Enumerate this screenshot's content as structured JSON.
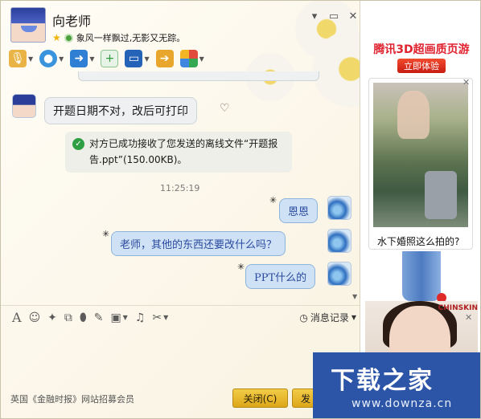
{
  "header": {
    "contact_name": "向老师",
    "signature": "象风一样飘过,无影又无踪。",
    "window_controls": [
      "▾",
      "▭",
      "✕"
    ]
  },
  "toolbar": {
    "items": [
      {
        "name": "voice",
        "icon": "microphone-icon",
        "color": "#e0a42c"
      },
      {
        "name": "video",
        "icon": "webcam-icon",
        "color": "#2f8fd8"
      },
      {
        "name": "file",
        "icon": "folder-send-icon",
        "color": "#2d7fd4"
      },
      {
        "name": "chat-add",
        "icon": "add-chat-icon",
        "color": "#3aa44c"
      },
      {
        "name": "remote",
        "icon": "remote-desktop-icon",
        "color": "#2563b8"
      },
      {
        "name": "share",
        "icon": "share-screen-icon",
        "color": "#e0a22a"
      },
      {
        "name": "apps",
        "icon": "apps-grid-icon",
        "color": "#d94e3a"
      }
    ]
  },
  "chat": {
    "msg_left": "开题日期不对，改后可打印",
    "system_msg": "对方已成功接收了您发送的离线文件“开题报告.ppt”(150.00KB)。",
    "timestamp": "11:25:19",
    "msg_r1": "恩恩",
    "msg_r2": "老师，其他的东西还要改什么吗？",
    "msg_r3": "PPT什么的"
  },
  "input_toolbar": {
    "history_label": "消息记录"
  },
  "footer": {
    "ad_text": "英国《金融时报》网站招募会员",
    "close_label": "关闭(C)",
    "send_label": "发"
  },
  "side_ad": {
    "title": "腾讯3D超画质页游",
    "cta": "立即体验",
    "photo_caption": "水下婚照这么拍的?",
    "brand": "CHINSKIN"
  },
  "watermark": {
    "title": "下载之家",
    "url": "www.downza.cn"
  }
}
